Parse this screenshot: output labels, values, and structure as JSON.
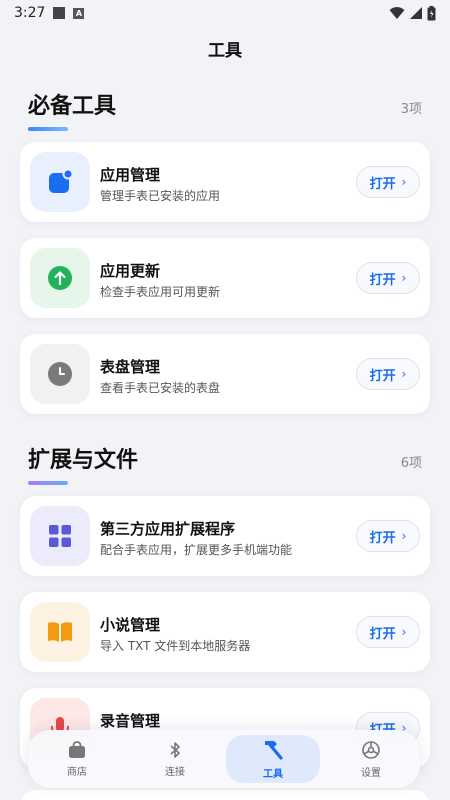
{
  "status_bar": {
    "time": "3:27",
    "notif_icon_a": "A"
  },
  "header": {
    "title": "工具"
  },
  "sections": [
    {
      "title": "必备工具",
      "count": "3项",
      "accent": "#4b8df8",
      "items": [
        {
          "title": "应用管理",
          "desc": "管理手表已安装的应用",
          "button": "打开",
          "icon": "app-manage-icon",
          "icon_color": "#1a6cf0"
        },
        {
          "title": "应用更新",
          "desc": "检查手表应用可用更新",
          "button": "打开",
          "icon": "update-arrow-icon",
          "icon_color": "#22b25a"
        },
        {
          "title": "表盘管理",
          "desc": "查看手表已安装的表盘",
          "button": "打开",
          "icon": "clock-icon",
          "icon_color": "#7a7a7a"
        }
      ]
    },
    {
      "title": "扩展与文件",
      "count": "6项",
      "accent": "#a77ef5",
      "items": [
        {
          "title": "第三方应用扩展程序",
          "desc": "配合手表应用，扩展更多手机端功能",
          "button": "打开",
          "icon": "grid-icon",
          "icon_color": "#5a5ad8"
        },
        {
          "title": "小说管理",
          "desc": "导入 TXT 文件到本地服务器",
          "button": "打开",
          "icon": "book-icon",
          "icon_color": "#f39a12"
        },
        {
          "title": "录音管理",
          "desc": "",
          "button": "打开",
          "icon": "microphone-icon",
          "icon_color": "#e54848"
        }
      ]
    }
  ],
  "tabbar": {
    "tabs": [
      {
        "label": "商店",
        "icon": "shopping-bag-icon"
      },
      {
        "label": "连接",
        "icon": "bluetooth-icon"
      },
      {
        "label": "工具",
        "icon": "hammer-icon",
        "active": true
      },
      {
        "label": "设置",
        "icon": "settings-icon"
      }
    ]
  }
}
